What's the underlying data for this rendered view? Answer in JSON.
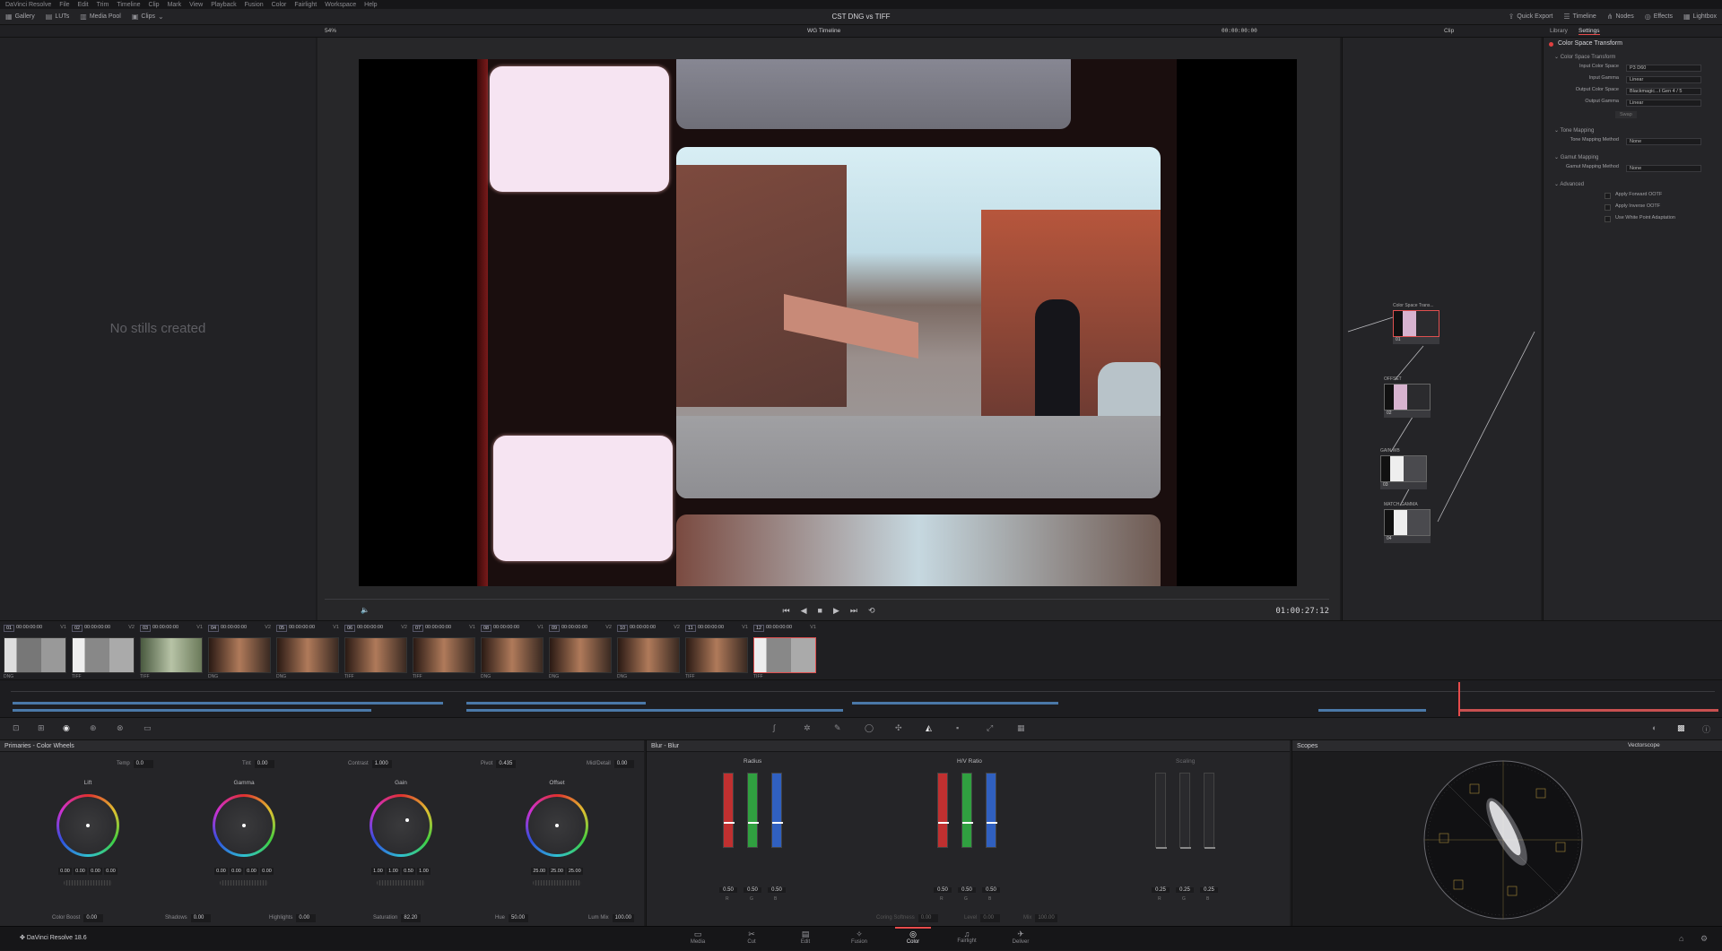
{
  "menu": [
    "DaVinci Resolve",
    "File",
    "Edit",
    "Trim",
    "Timeline",
    "Clip",
    "Mark",
    "View",
    "Playback",
    "Fusion",
    "Color",
    "Fairlight",
    "Workspace",
    "Help"
  ],
  "project_title": "CST DNG vs TIFF",
  "header_left": {
    "gallery": "Gallery",
    "luts": "LUTs",
    "media_pool": "Media Pool",
    "clips": "Clips"
  },
  "header_right": {
    "quick_export": "Quick Export",
    "timeline": "Timeline",
    "nodes": "Nodes",
    "effects": "Effects",
    "lightbox": "Lightbox"
  },
  "toolstrip": {
    "zoom": "54%",
    "timeline_name": "WG Timeline",
    "timecode": "00:00:00:00",
    "clip_mode": "Clip",
    "library": "Library",
    "settings": "Settings"
  },
  "gallery": {
    "empty_text": "No stills created"
  },
  "viewer": {
    "timecode": "01:00:27:12"
  },
  "inspector": {
    "title": "Color Space Transform",
    "section_cst": "Color Space Transform",
    "input_color_space_label": "Input Color Space",
    "input_color_space": "P3 D60",
    "input_gamma_label": "Input Gamma",
    "input_gamma": "Linear",
    "output_color_space_label": "Output Color Space",
    "output_color_space": "Blackmagic...t Gen 4 / 5",
    "output_gamma_label": "Output Gamma",
    "output_gamma": "Linear",
    "swap": "Swap",
    "section_tone": "Tone Mapping",
    "tone_method_label": "Tone Mapping Method",
    "tone_method": "None",
    "section_gamut": "Gamut Mapping",
    "gamut_method_label": "Gamut Mapping Method",
    "gamut_method": "None",
    "section_adv": "Advanced",
    "apply_fwd": "Apply Forward OOTF",
    "apply_inv": "Apply Inverse OOTF",
    "white_point": "Use White Point Adaptation"
  },
  "nodes": [
    {
      "label": "Color Space Trans...",
      "num": "01"
    },
    {
      "label": "OFFSET",
      "num": "02"
    },
    {
      "label": "GAIN WB",
      "num": "03"
    },
    {
      "label": "MATCH GAMMA",
      "num": "04"
    }
  ],
  "clips": [
    {
      "num": "01",
      "tc": "00:00:00:00",
      "track": "V1",
      "fmt": "DNG"
    },
    {
      "num": "02",
      "tc": "00:00:00:00",
      "track": "V2",
      "fmt": "TIFF"
    },
    {
      "num": "03",
      "tc": "00:00:00:00",
      "track": "V1",
      "fmt": "TIFF"
    },
    {
      "num": "04",
      "tc": "00:00:00:00",
      "track": "V2",
      "fmt": "DNG"
    },
    {
      "num": "05",
      "tc": "00:00:00:00",
      "track": "V1",
      "fmt": "DNG"
    },
    {
      "num": "06",
      "tc": "00:00:00:00",
      "track": "V2",
      "fmt": "TIFF"
    },
    {
      "num": "07",
      "tc": "00:00:00:00",
      "track": "V1",
      "fmt": "TIFF"
    },
    {
      "num": "08",
      "tc": "00:00:00:00",
      "track": "V1",
      "fmt": "DNG"
    },
    {
      "num": "09",
      "tc": "00:00:00:00",
      "track": "V2",
      "fmt": "DNG"
    },
    {
      "num": "10",
      "tc": "00:00:00:00",
      "track": "V2",
      "fmt": "DNG"
    },
    {
      "num": "11",
      "tc": "00:00:00:00",
      "track": "V1",
      "fmt": "TIFF"
    },
    {
      "num": "12",
      "tc": "00:00:00:00",
      "track": "V1",
      "fmt": "TIFF"
    }
  ],
  "primaries": {
    "title": "Primaries - Color Wheels",
    "temp_label": "Temp",
    "temp": "0.0",
    "tint_label": "Tint",
    "tint": "0.00",
    "contrast_label": "Contrast",
    "contrast": "1.000",
    "pivot_label": "Pivot",
    "pivot": "0.435",
    "middetail_label": "Mid/Detail",
    "middetail": "0.00",
    "wheels": [
      {
        "name": "Lift",
        "vals": [
          "0.00",
          "0.00",
          "0.00",
          "0.00"
        ]
      },
      {
        "name": "Gamma",
        "vals": [
          "0.00",
          "0.00",
          "0.00",
          "0.00"
        ]
      },
      {
        "name": "Gain",
        "vals": [
          "1.00",
          "1.00",
          "0.50",
          "1.00"
        ]
      },
      {
        "name": "Offset",
        "vals": [
          "25.00",
          "25.00",
          "25.00"
        ]
      }
    ],
    "colorboost_label": "Color Boost",
    "colorboost": "0.00",
    "shadows_label": "Shadows",
    "shadows": "0.00",
    "highlights_label": "Highlights",
    "highlights": "0.00",
    "saturation_label": "Saturation",
    "saturation": "82.20",
    "hue_label": "Hue",
    "hue": "50.00",
    "lummix_label": "Lum Mix",
    "lummix": "100.00"
  },
  "blur": {
    "title": "Blur - Blur",
    "radius_label": "Radius",
    "radius": [
      "0.50",
      "0.50",
      "0.50"
    ],
    "hv_label": "H/V Ratio",
    "hv": [
      "0.50",
      "0.50",
      "0.50"
    ],
    "scaling_label": "Scaling",
    "scaling": [
      "0.25",
      "0.25",
      "0.25"
    ],
    "channels": [
      "R",
      "G",
      "B"
    ],
    "coring_label": "Coring Softness",
    "coring": "0.00",
    "level_label": "Level",
    "level": "0.00",
    "mix_label": "Mix",
    "mix": "100.00"
  },
  "scopes": {
    "title": "Scopes",
    "mode": "Vectorscope"
  },
  "app_version": "DaVinci Resolve 18.6",
  "pages": [
    "Media",
    "Cut",
    "Edit",
    "Fusion",
    "Color",
    "Fairlight",
    "Deliver"
  ],
  "active_page": "Color"
}
